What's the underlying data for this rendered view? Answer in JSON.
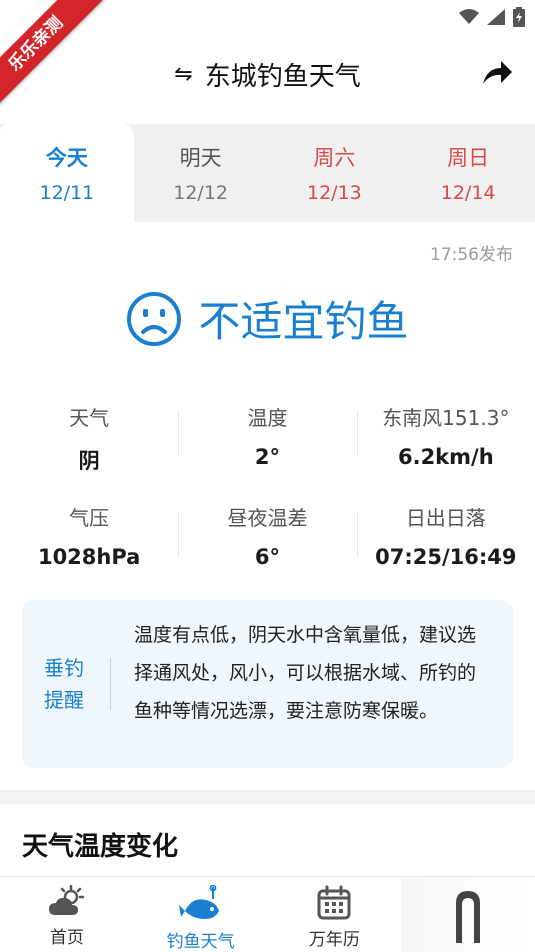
{
  "status_bar": {
    "wifi_icon": "wifi-icon",
    "signal_icon": "signal-icon",
    "battery_icon": "battery-icon"
  },
  "ribbon": {
    "text": "乐乐亲测"
  },
  "header": {
    "title": "东城钓鱼天气",
    "swap_icon": "⇋",
    "share_icon": "share-icon"
  },
  "tabs": [
    {
      "day": "今天",
      "date": "12/11",
      "active": true,
      "weekend": false
    },
    {
      "day": "明天",
      "date": "12/12",
      "active": false,
      "weekend": false
    },
    {
      "day": "周六",
      "date": "12/13",
      "active": false,
      "weekend": true
    },
    {
      "day": "周日",
      "date": "12/14",
      "active": false,
      "weekend": true
    }
  ],
  "publish_time": "17:56发布",
  "verdict": {
    "text": "不适宜钓鱼",
    "icon": "sad-face-icon"
  },
  "stats": {
    "row1": [
      {
        "label": "天气",
        "value": "阴"
      },
      {
        "label": "温度",
        "value": "2°"
      },
      {
        "label": "东南风151.3°",
        "value": "6.2km/h"
      }
    ],
    "row2": [
      {
        "label": "气压",
        "value": "1028hPa"
      },
      {
        "label": "昼夜温差",
        "value": "6°"
      },
      {
        "label": "日出日落",
        "value": "07:25/16:49"
      }
    ]
  },
  "tip": {
    "label": "垂钓提醒",
    "text": "温度有点低，阴天水中含氧量低，建议选择通风处，风小，可以根据水域、所钓的鱼种等情况选漂，要注意防寒保暖。"
  },
  "section_title": "天气温度变化",
  "bottom_nav": [
    {
      "label": "首页",
      "icon": "weather-cloud-icon",
      "active": false
    },
    {
      "label": "钓鱼天气",
      "icon": "fish-icon",
      "active": true
    },
    {
      "label": "万年历",
      "icon": "calendar-icon",
      "active": false
    },
    {
      "label": "",
      "icon": "arch-icon",
      "active": false
    }
  ],
  "colors": {
    "accent": "#1a7fd1",
    "weekend": "#d84a4a",
    "ribbon": "#d3242a",
    "tip_bg": "#eff6fc"
  }
}
